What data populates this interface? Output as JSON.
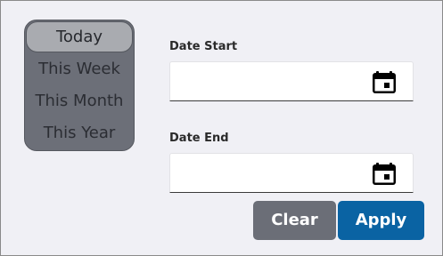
{
  "quick_range": {
    "items": [
      {
        "label": "Today"
      },
      {
        "label": "This Week"
      },
      {
        "label": "This Month"
      },
      {
        "label": "This Year"
      }
    ],
    "selected": "Today"
  },
  "date_start": {
    "label": "Date Start",
    "value": "",
    "icon": "calendar-icon"
  },
  "date_end": {
    "label": "Date End",
    "value": "",
    "icon": "calendar-icon"
  },
  "buttons": {
    "clear_label": "Clear",
    "apply_label": "Apply"
  },
  "colors": {
    "apply": "#0a63a3",
    "clear": "#6b6e77",
    "list_bg": "#6c6f78",
    "selected_bg": "#a9abb0"
  }
}
